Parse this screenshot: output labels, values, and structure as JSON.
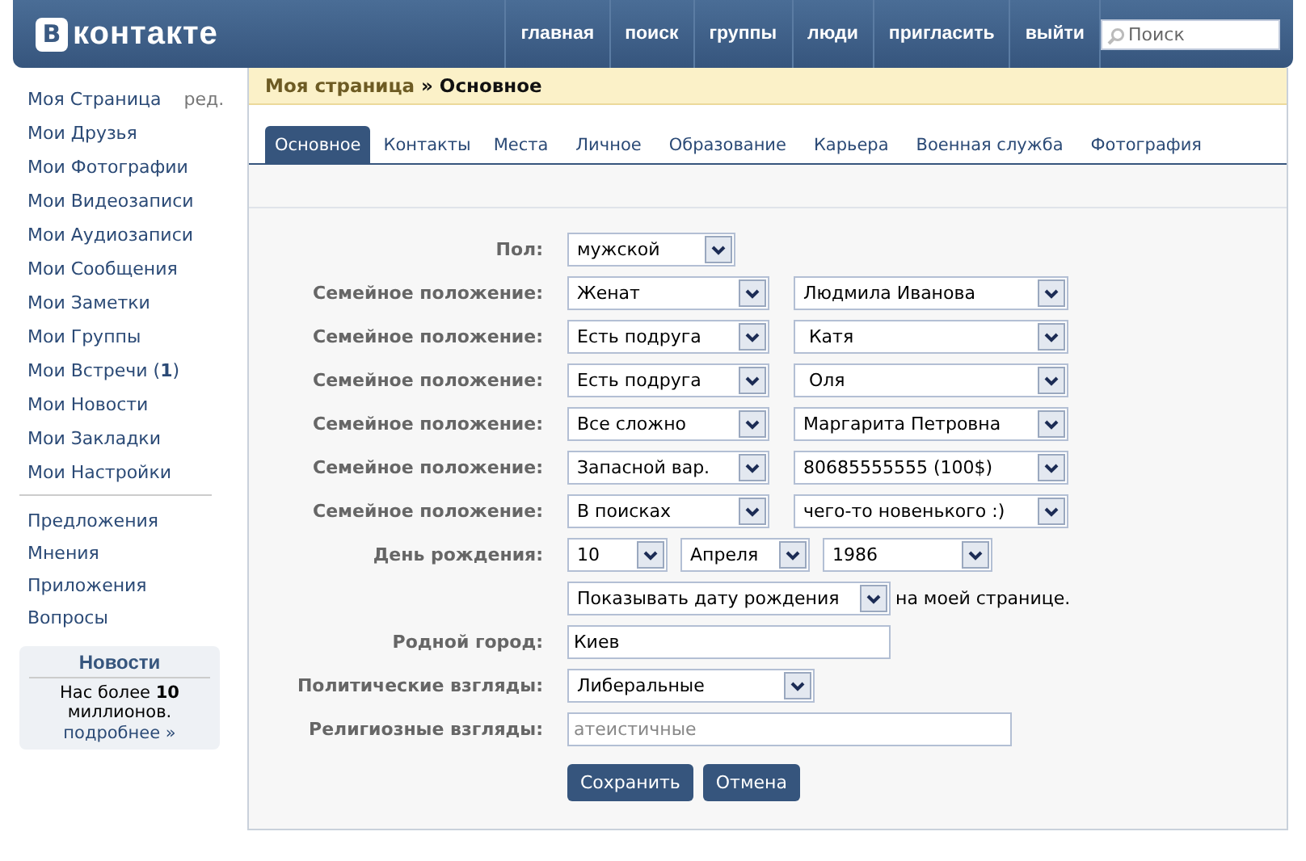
{
  "header": {
    "logo_mark": "В",
    "logo_text": "контакте",
    "nav": [
      "главная",
      "поиск",
      "группы",
      "люди",
      "пригласить",
      "выйти"
    ],
    "search": {
      "placeholder": "Поиск"
    }
  },
  "sidebar": {
    "items": [
      {
        "label": "Моя Страница",
        "edit": "ред."
      },
      {
        "label": "Мои Друзья"
      },
      {
        "label": "Мои Фотографии"
      },
      {
        "label": "Мои Видеозаписи"
      },
      {
        "label": "Мои Аудиозаписи"
      },
      {
        "label": "Мои Сообщения"
      },
      {
        "label": "Мои Заметки"
      },
      {
        "label": "Мои Группы"
      },
      {
        "label": "Мои Встречи (**1**)"
      },
      {
        "label": "Мои Новости"
      },
      {
        "label": "Мои Закладки"
      },
      {
        "label": "Мои Настройки"
      }
    ],
    "extra_items": [
      "Предложения",
      "Мнения",
      "Приложения",
      "Вопросы"
    ],
    "news": {
      "title": "Новости",
      "text": "Нас более **10** миллионов.",
      "link": "подробнее »"
    }
  },
  "breadcrumb": {
    "parent": "Моя страница",
    "current": "» Основное"
  },
  "tabs": [
    {
      "label": "Основное",
      "selected": true
    },
    {
      "label": "Контакты",
      "selected": false
    },
    {
      "label": "Места",
      "selected": false
    },
    {
      "label": "Личное",
      "selected": false
    },
    {
      "label": "Образование",
      "selected": false
    },
    {
      "label": "Карьера",
      "selected": false
    },
    {
      "label": "Военная служба",
      "selected": false
    },
    {
      "label": "Фотография",
      "selected": false
    }
  ],
  "form": [
    {
      "kind": "gender",
      "label": "Пол:",
      "controls": [
        {
          "kind": "select",
          "value": "мужской"
        }
      ]
    },
    {
      "kind": "relation",
      "label": "Семейное положение:",
      "controls": [
        {
          "kind": "select",
          "value": "Женат"
        },
        {
          "kind": "select",
          "value": "Людмила Иванова"
        }
      ]
    },
    {
      "kind": "relation",
      "label": "Семейное положение:",
      "controls": [
        {
          "kind": "select",
          "value": "Есть подруга"
        },
        {
          "kind": "select",
          "value": " Катя"
        }
      ]
    },
    {
      "kind": "relation",
      "label": "Семейное положение:",
      "controls": [
        {
          "kind": "select",
          "value": "Есть подруга"
        },
        {
          "kind": "select",
          "value": " Оля"
        }
      ]
    },
    {
      "kind": "relation",
      "label": "Семейное положение:",
      "controls": [
        {
          "kind": "select",
          "value": "Все сложно"
        },
        {
          "kind": "select",
          "value": "Маргарита Петровна"
        }
      ]
    },
    {
      "kind": "relation",
      "label": "Семейное положение:",
      "controls": [
        {
          "kind": "select",
          "value": "Запасной вар."
        },
        {
          "kind": "select",
          "value": "80685555555 (100$)"
        }
      ]
    },
    {
      "kind": "relation",
      "label": "Семейное положение:",
      "controls": [
        {
          "kind": "select",
          "value": "В поисках"
        },
        {
          "kind": "select",
          "value": "чего-то новенького :)"
        }
      ]
    },
    {
      "kind": "birthday",
      "label": "День рождения:",
      "controls": [
        {
          "kind": "select",
          "value": "10"
        },
        {
          "kind": "select",
          "value": "Апреля"
        },
        {
          "kind": "select",
          "value": "1986"
        }
      ]
    },
    {
      "kind": "visibility",
      "controls": [
        {
          "kind": "select",
          "value": "Показывать дату рождения"
        }
      ],
      "suffix": "на моей странице."
    },
    {
      "kind": "hometown",
      "label": "Родной город:",
      "controls": [
        {
          "kind": "text",
          "value": "Киев"
        }
      ]
    },
    {
      "kind": "politics",
      "label": "Политические взгляды:",
      "controls": [
        {
          "kind": "select",
          "value": "Либеральные"
        }
      ]
    },
    {
      "kind": "religion",
      "label": "Религиозные взгляды:",
      "controls": [
        {
          "kind": "text",
          "placeholder": "атеистичные"
        }
      ]
    }
  ],
  "buttons": [
    "Сохранить",
    "Отмена"
  ]
}
